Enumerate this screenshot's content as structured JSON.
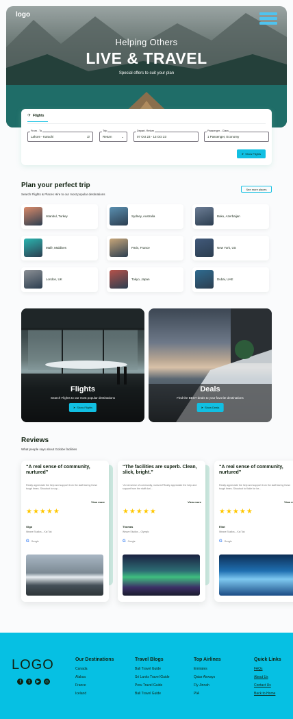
{
  "hero": {
    "logo": "logo",
    "subtitle": "Helping Others",
    "title": "LIVE & TRAVEL",
    "offers": "Special offers to suit your plan"
  },
  "search": {
    "tab": "Flights",
    "from_label": "From - To",
    "from_value": "Lahore - Karachi",
    "trip_label": "Trip",
    "trip_value": "Return",
    "dates_label": "Depart- Return",
    "dates_value": "07 Oct 23 - 13 Oct 23",
    "pass_label": "Passenger - Class",
    "pass_value": "1 Passenger, Economy",
    "button": "Show Flights"
  },
  "plan": {
    "title": "Plan your perfect trip",
    "subtitle": "Search Flights & Places Hire to our most popular destinations",
    "see_more": "See more places",
    "places": [
      {
        "name": "Istanbul, Turkey",
        "color": "#d98a6a"
      },
      {
        "name": "Sydney, Australia",
        "color": "#5a8fb0"
      },
      {
        "name": "Baku, Azerbaijan",
        "color": "#6c7d95"
      },
      {
        "name": "Malé, Maldives",
        "color": "#2bb5b0"
      },
      {
        "name": "Paris, France",
        "color": "#c7a679"
      },
      {
        "name": "New York, US",
        "color": "#41597a"
      },
      {
        "name": "London, UK",
        "color": "#8b8f94"
      },
      {
        "name": "Tokyo, Japan",
        "color": "#b5524a"
      },
      {
        "name": "Dubai, UAE",
        "color": "#2f6b8f"
      }
    ]
  },
  "promos": [
    {
      "title": "Flights",
      "desc": "Search Flights to our most popular destinations",
      "button": "Show Flights"
    },
    {
      "title": "Deals",
      "desc": "Find the BEST deals to your favorite destinations",
      "button": "Show Deals"
    }
  ],
  "reviews": {
    "title": "Reviews",
    "subtitle": "What people says about Golobe facilities",
    "view_more": "View more",
    "google": "Google",
    "items": [
      {
        "quote": "“A real sense of community, nurtured”",
        "body": "Really appreciate the help and support from the staff during these tough times. Shoutout to sup...",
        "name": "Olga",
        "company": "Weave Studios – Kai Tak"
      },
      {
        "quote": "“The facilities are superb. Clean, slick, bright.”",
        "body": "“A real sense of community, nurtured”Really appreciate the help and support from the staff duri...",
        "name": "Thomas",
        "company": "Weave Studios – Olympic"
      },
      {
        "quote": "“A real sense of community, nurtured”",
        "body": "Really appreciate the help and support from the staff during these tough times. Shoutout to Katie for he...",
        "name": "Eliot",
        "company": "Weave Studios – Kai Tak"
      }
    ]
  },
  "footer": {
    "logo": "LOGO",
    "cols": [
      {
        "heading": "Our Destinations",
        "items": [
          "Canada",
          "Alaksa",
          "France",
          "Iceland"
        ]
      },
      {
        "heading": "Travel Blogs",
        "items": [
          "Bali Travel Guide",
          "Sri Lanks Travel Guide",
          "Peru Travel Guide",
          "Bali Travel Guide"
        ]
      },
      {
        "heading": "Top Airlines",
        "items": [
          "Emirates",
          "Qatar Airways",
          "Fly Jinnah",
          "PIA"
        ]
      },
      {
        "heading": "Quick Links",
        "items": [
          "FAQs",
          "About Us",
          "Contact Us",
          "Back to Home"
        ]
      }
    ]
  }
}
